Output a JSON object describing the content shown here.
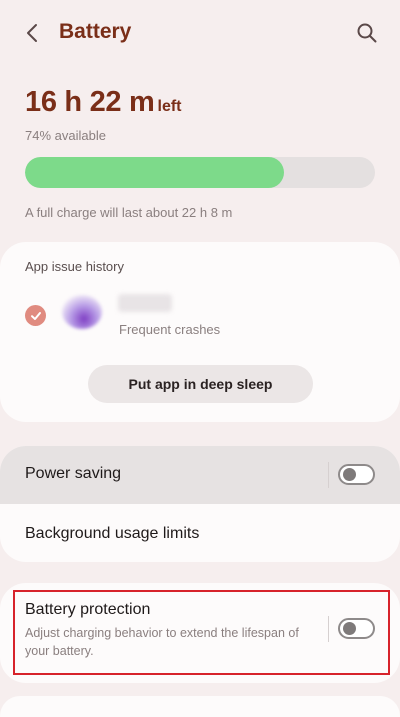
{
  "header": {
    "title": "Battery",
    "back_icon": "back-arrow-icon",
    "search_icon": "search-icon"
  },
  "battery": {
    "time_left": "16 h 22 m",
    "time_left_suffix": "left",
    "available": "74% available",
    "level_percent": 74,
    "full_charge_text": "A full charge will last about 22 h 8 m",
    "fill_color": "#7dda8a"
  },
  "app_issue": {
    "heading": "App issue history",
    "item_status": "Frequent crashes",
    "action_label": "Put app in deep sleep"
  },
  "settings": {
    "power_saving": {
      "label": "Power saving",
      "enabled": false
    },
    "background_limits": {
      "label": "Background usage limits"
    },
    "battery_protection": {
      "label": "Battery protection",
      "description": "Adjust charging behavior to extend the lifespan of your battery.",
      "enabled": false
    }
  },
  "colors": {
    "accent": "#7a2e18",
    "highlight": "#d7232b",
    "background": "#f6eeee"
  }
}
